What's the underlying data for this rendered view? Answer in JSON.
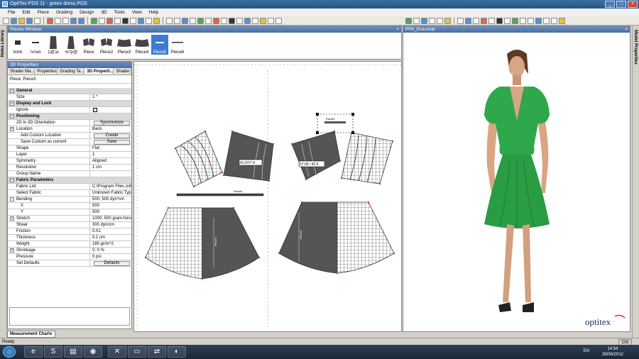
{
  "window": {
    "title": "OptiTex PDS 11 - green dress.PDS"
  },
  "menu": [
    "File",
    "Edit",
    "Piece",
    "Grading",
    "Design",
    "3D",
    "Tools",
    "View",
    "Help"
  ],
  "side": {
    "left_label": "Rules Library",
    "right_label": "Model Properties"
  },
  "pieces_window": {
    "title": "Pieces Window",
    "pieces": [
      "ספוס",
      "מצחה",
      "גב@1",
      "קדמי@",
      "Piece",
      "Piece2",
      "Piece3",
      "Piece4",
      "Piece5",
      "Piece6"
    ],
    "selected": "Piece5"
  },
  "properties": {
    "title": "3D Properties",
    "tabs": [
      "Shader Ma...",
      "Properties",
      "Grading Ta...",
      "3D Properti...",
      "Shader"
    ],
    "active_tab": "3D Properti...",
    "piece_label": "Piece: Piece5",
    "categories": {
      "general": "General",
      "display": "Display and Lock",
      "positioning": "Positioning",
      "fabric": "Fabric Parameters"
    },
    "rows": {
      "size": {
        "k": "Size",
        "v": "1 *"
      },
      "ignore": {
        "k": "Ignore"
      },
      "orientation": {
        "k": "2D to 3D Orientation",
        "btn": "Synchronize"
      },
      "location": {
        "k": "Location",
        "v": "Back"
      },
      "add_custom": {
        "k": "Add Custom Location",
        "btn": "Create"
      },
      "save_custom": {
        "k": "Save Custom as current",
        "btn": "Save"
      },
      "shape": {
        "k": "Shape",
        "v": "Flat"
      },
      "layer": {
        "k": "Layer",
        "v": "1"
      },
      "symmetry": {
        "k": "Symmetry",
        "v": "Aligned"
      },
      "resolution": {
        "k": "Resolution",
        "v": "1 cm"
      },
      "group": {
        "k": "Group Name",
        "v": ""
      },
      "fabric_list": {
        "k": "Fabric List",
        "v": "C:\\Program Files (x86..."
      },
      "select_fabric": {
        "k": "Select Fabric",
        "v": "Unknown Fabric Type"
      },
      "bending": {
        "k": "Bending",
        "v": "500; 500 dyn*cm"
      },
      "x": {
        "k": "X",
        "v": "500"
      },
      "y": {
        "k": "Y",
        "v": "500"
      },
      "stretch": {
        "k": "Stretch",
        "v": "1000; 500 gram-force"
      },
      "shear": {
        "k": "Shear",
        "v": "300 dyn/cm"
      },
      "friction": {
        "k": "Friction",
        "v": "0.01"
      },
      "thickness": {
        "k": "Thickness",
        "v": "0.1 cm"
      },
      "weight": {
        "k": "Weight",
        "v": "180 gr/m^2"
      },
      "shrinkage": {
        "k": "Shrinkage",
        "v": "0; 0 %"
      },
      "pressure": {
        "k": "Pressure",
        "v": "0 psi"
      },
      "set_defaults": {
        "k": "Set Defaults",
        "btn": "Defaults"
      }
    },
    "bottom_tab": "Measurement Charts"
  },
  "canvas": {
    "dim_left": "41.97/7.4",
    "dim_right": "57.06 / 42.9",
    "piece_labels": [
      "Piece6",
      "Piece5",
      "Piece3",
      "Piece4",
      "Piece2"
    ]
  },
  "model_view": {
    "title": "PFA_Eva.mod",
    "logo": "optitex"
  },
  "status": {
    "text": "Ready",
    "units": "CM"
  },
  "taskbar": {
    "lang": "EN",
    "time": "14:54",
    "date": "29/08/2012"
  },
  "colors": {
    "dress": "#2ea84a",
    "selection": "#3a7bd5",
    "titlebar": "#2a5587"
  }
}
